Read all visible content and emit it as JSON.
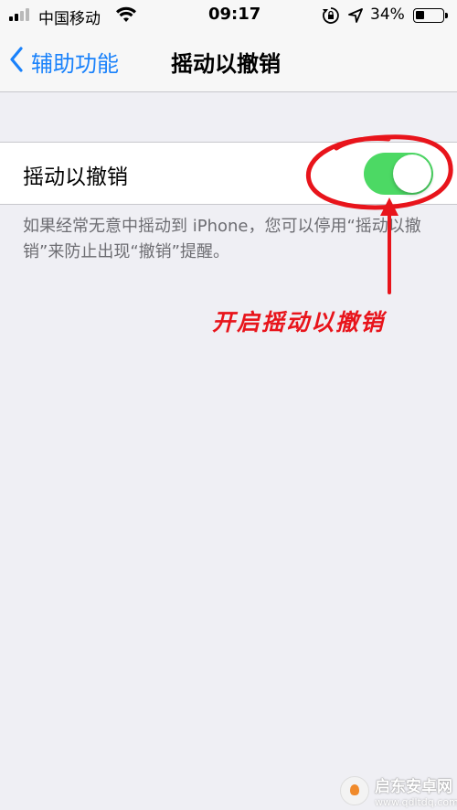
{
  "status_bar": {
    "carrier": "中国移动",
    "time": "09:17",
    "battery_percent": "34%",
    "battery_level": 0.34,
    "signal_bars_active": 2,
    "icons": [
      "signal-icon",
      "wifi-icon",
      "rotation-lock-icon",
      "location-icon",
      "battery-icon"
    ]
  },
  "nav": {
    "back_label": "辅助功能",
    "title": "摇动以撤销"
  },
  "setting": {
    "label": "摇动以撤销",
    "toggle_on": true,
    "toggle_color": "#4cd964"
  },
  "footnote": "如果经常无意中摇动到 iPhone，您可以停用“摇动以撤销”来防止出现“撤销”提醒。",
  "annotation": {
    "text": "开启摇动以撤销",
    "color": "#e8141b"
  },
  "watermark": {
    "title": "启东安卓网",
    "url": "www.qdltdq.com"
  },
  "colors": {
    "accent": "#1a82fb",
    "background": "#efeff4"
  }
}
